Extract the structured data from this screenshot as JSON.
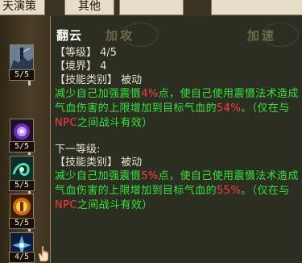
{
  "tabs": {
    "tab1": "天演策",
    "tab2": "其他"
  },
  "skills": [
    {
      "name": "skill-1",
      "count": "5/5",
      "icon": "figure-on-cliff-icon"
    },
    {
      "name": "skill-2",
      "count": "5/5",
      "icon": "purple-orb-icon"
    },
    {
      "name": "skill-3",
      "count": "5/5",
      "icon": "green-swirl-icon"
    },
    {
      "name": "skill-4",
      "count": "5/5",
      "icon": "golden-aura-icon"
    },
    {
      "name": "skill-5",
      "count": "4/5",
      "icon": "blue-burst-icon"
    }
  ],
  "tooltip": {
    "skill_name": "翻云",
    "tag_attack": "加攻",
    "tag_speed": "加速",
    "level_label": "【等级】",
    "level_value": "4/5",
    "realm_label": "【境界】",
    "realm_value": "4",
    "type_label": "【技能类别】",
    "type_value": "被动",
    "current": {
      "text_a": "减少自己加强震慑",
      "pct_1": "4%",
      "text_b": "点，使自己使用震慑法术造成气血伤害的上限增加到目标气血的",
      "pct_2": "54%",
      "text_c": "。（仅在与",
      "npc": "NPC",
      "text_d": "之间战斗有效）"
    },
    "next_label": "下一等级:",
    "next": {
      "text_a": "减少自己加强震慑",
      "pct_1": "5%",
      "text_b": "点，使自己使用震慑法术造成气血伤害的上限增加到目标气血的",
      "pct_2": "55%",
      "text_c": "。（仅在与",
      "npc": "NPC",
      "text_d": "之间战斗有效）"
    }
  },
  "colors": {
    "green_text": "#33e43a",
    "red_text": "#ff3b3b",
    "panel_bg": "#292c1f"
  }
}
